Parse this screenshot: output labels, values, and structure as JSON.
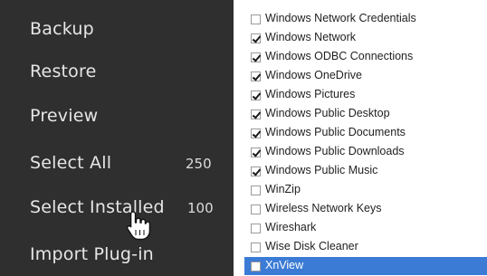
{
  "sidebar": {
    "items": [
      {
        "label": "Backup"
      },
      {
        "label": "Restore"
      },
      {
        "label": "Preview"
      },
      {
        "label": "Select All",
        "count": "250"
      },
      {
        "label": "Select Installed",
        "count": "100"
      },
      {
        "label": "Import Plug-in"
      }
    ]
  },
  "list": {
    "items": [
      {
        "label": "Windows Network Credentials",
        "checked": false
      },
      {
        "label": "Windows Network",
        "checked": true
      },
      {
        "label": "Windows ODBC Connections",
        "checked": true
      },
      {
        "label": "Windows OneDrive",
        "checked": true
      },
      {
        "label": "Windows Pictures",
        "checked": true
      },
      {
        "label": "Windows Public Desktop",
        "checked": true
      },
      {
        "label": "Windows Public Documents",
        "checked": true
      },
      {
        "label": "Windows Public Downloads",
        "checked": true
      },
      {
        "label": "Windows Public Music",
        "checked": true
      },
      {
        "label": "WinZip",
        "checked": false
      },
      {
        "label": "Wireless Network Keys",
        "checked": false
      },
      {
        "label": "Wireshark",
        "checked": false
      },
      {
        "label": "Wise Disk Cleaner",
        "checked": false
      },
      {
        "label": "XnView",
        "checked": false,
        "selected": true
      }
    ]
  },
  "colors": {
    "sidebar_bg": "#2f2f2f",
    "selection": "#3b7bd6"
  }
}
